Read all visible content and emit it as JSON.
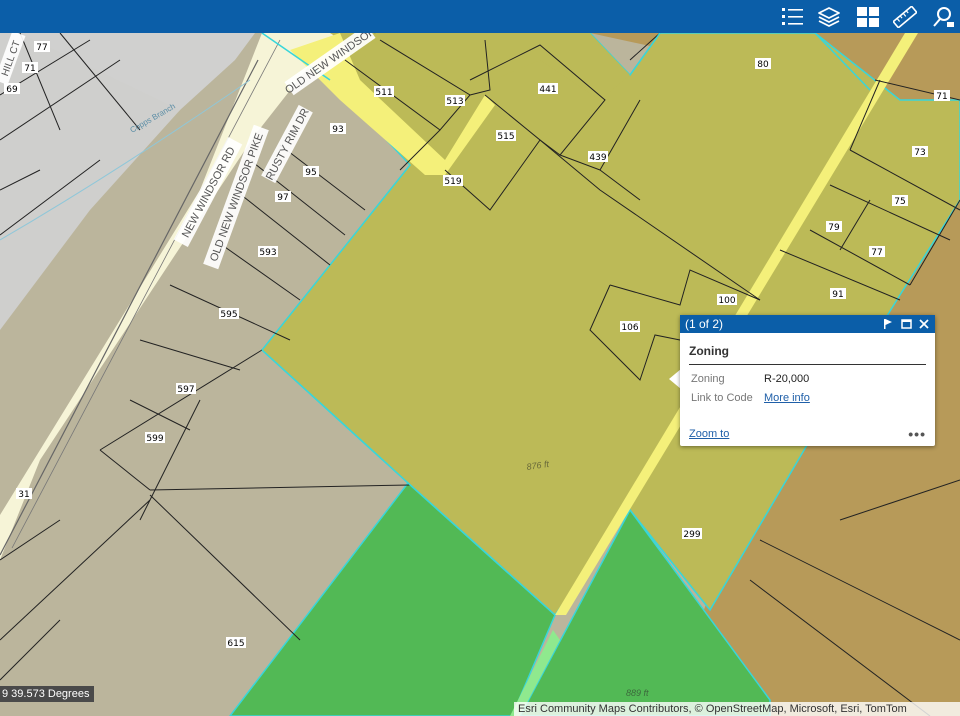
{
  "toolbar": {
    "tools": [
      {
        "name": "legend",
        "icon": "list-icon"
      },
      {
        "name": "layers",
        "icon": "layers-icon"
      },
      {
        "name": "basemap",
        "icon": "grid-icon"
      },
      {
        "name": "measure",
        "icon": "ruler-icon"
      },
      {
        "name": "search",
        "icon": "search-icon"
      }
    ]
  },
  "streets": {
    "new_windsor_rd": "NEW WINDSOR RD",
    "old_new_windsor_pike": "OLD NEW WINDSOR PIKE",
    "rusty_rim_dr": "RUSTY RIM DR",
    "old_new_windsor_top": "OLD NEW WINDSOR",
    "hill_ct": "HILL CT",
    "copps_branch": "Copps Branch"
  },
  "parcels": [
    "77",
    "71",
    "69",
    "511",
    "513",
    "441",
    "80",
    "71",
    "93",
    "515",
    "439",
    "73",
    "95",
    "519",
    "75",
    "97",
    "79",
    "77",
    "593",
    "91",
    "100",
    "595",
    "106",
    "597",
    "599",
    "299",
    "615",
    "31"
  ],
  "elevations": {
    "e1": "876 ft",
    "e2": "889 ft"
  },
  "popup": {
    "pager": "(1 of 2)",
    "title": "Zoning",
    "rows": [
      {
        "key": "Zoning",
        "value": "R-20,000"
      },
      {
        "key": "Link to Code",
        "value": "More info"
      }
    ],
    "zoom_to": "Zoom to",
    "more": "•••"
  },
  "coords": "9 39.573 Degrees",
  "attribution": "Esri Community Maps Contributors, © OpenStreetMap, Microsoft, Esri, TomTom",
  "colors": {
    "toolbar": "#0b5ea8",
    "residential_zone": "#bcba57",
    "green_zone": "#52b955",
    "brown_zone": "#b79a59",
    "gray_parcels": "#bbb59c",
    "road": "#f6f4d7",
    "highlight": "#38d6da"
  }
}
